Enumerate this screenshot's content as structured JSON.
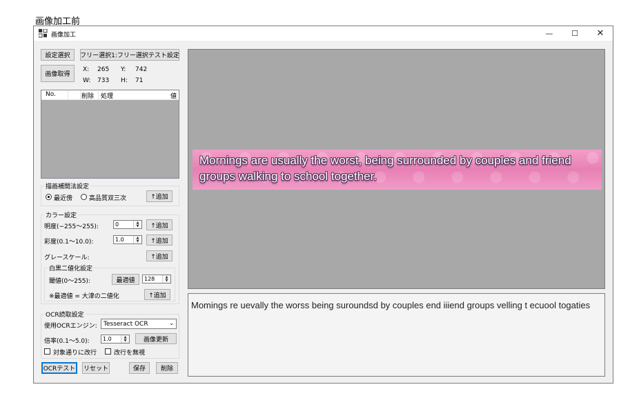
{
  "caption": "画像加工前",
  "window": {
    "title": "画像加工"
  },
  "controls": {
    "settings_select_button": "設定選択",
    "settings_value": "フリー選択1:フリー選択テスト設定",
    "capture_button": "画像取得",
    "coords": {
      "x_label": "X:",
      "x": "265",
      "y_label": "Y:",
      "y": "742",
      "w_label": "W:",
      "w": "733",
      "h_label": "H:",
      "h": "71"
    }
  },
  "process_list": {
    "columns": [
      "No.",
      "削除",
      "処理",
      "値"
    ],
    "rows": []
  },
  "interpolation": {
    "title": "描画補間法設定",
    "options": [
      {
        "label": "最近傍",
        "selected": true
      },
      {
        "label": "高品質双三次",
        "selected": false
      }
    ],
    "add_button": "↑追加"
  },
  "color": {
    "title": "カラー設定",
    "brightness_label": "明度(−255〜255):",
    "brightness_value": "0",
    "saturation_label": "彩度(0.1〜10.0):",
    "saturation_value": "1.0",
    "grayscale_label": "グレースケール:",
    "add_button": "↑追加",
    "binarize": {
      "title": "白黒二値化設定",
      "threshold_label": "閾値(0〜255):",
      "optimal_button": "最適値",
      "threshold_value": "128",
      "note": "※最適値 = 大津の二値化",
      "add_button": "↑追加"
    }
  },
  "ocr": {
    "title": "OCR読取設定",
    "engine_label": "使用OCRエンジン:",
    "engine_value": "Tesseract OCR",
    "scale_label": "倍率(0.1〜5.0):",
    "scale_value": "1.0",
    "refresh_button": "画像更新",
    "wrap_checkbox": "対象通りに改行",
    "ignore_newline_checkbox": "改行を無視"
  },
  "bottom_buttons": {
    "ocr_test": "OCRテスト",
    "reset": "リセット",
    "save": "保存",
    "delete": "削除"
  },
  "preview": {
    "text": "Mornings are usually the worst, being surrounded by couples and friend groups walking to school together."
  },
  "ocr_result": "Momings re uevally the worss being suroundsd by couples end iiiend groups velling t ecuool togaties",
  "colors": {
    "preview_bg": "#a8a8a8",
    "banner_pink": "#ec8cbe",
    "focus_blue": "#0078d7"
  }
}
